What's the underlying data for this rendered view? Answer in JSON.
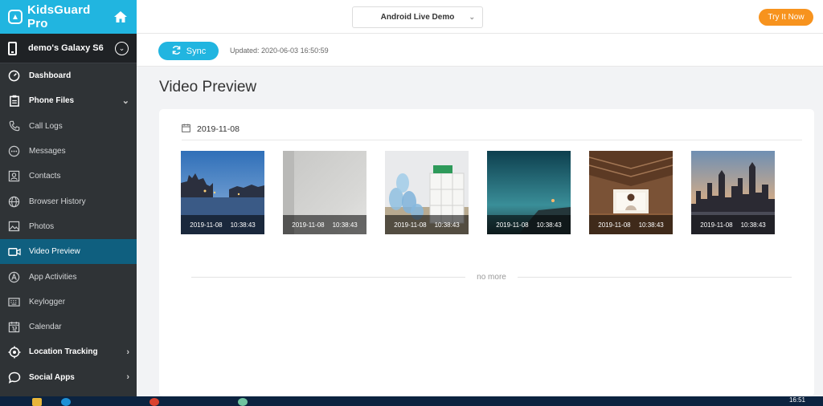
{
  "brand": {
    "name": "KidsGuard Pro"
  },
  "device": {
    "name": "demo's Galaxy S6"
  },
  "sidebar": {
    "items": [
      {
        "label": "Dashboard",
        "icon": "gauge-icon"
      },
      {
        "label": "Phone Files",
        "icon": "clipboard-icon"
      },
      {
        "label": "Call Logs",
        "icon": "phone-icon"
      },
      {
        "label": "Messages",
        "icon": "chat-icon"
      },
      {
        "label": "Contacts",
        "icon": "contact-icon"
      },
      {
        "label": "Browser History",
        "icon": "globe-icon"
      },
      {
        "label": "Photos",
        "icon": "image-icon"
      },
      {
        "label": "Video Preview",
        "icon": "video-icon"
      },
      {
        "label": "App Activities",
        "icon": "app-store-icon"
      },
      {
        "label": "Keylogger",
        "icon": "keyboard-icon"
      },
      {
        "label": "Calendar",
        "icon": "calendar-icon"
      },
      {
        "label": "Location Tracking",
        "icon": "location-icon"
      },
      {
        "label": "Social Apps",
        "icon": "social-chat-icon"
      }
    ]
  },
  "topbar": {
    "demo_label": "Android Live Demo",
    "try_label": "Try It Now"
  },
  "sync": {
    "label": "Sync",
    "updated": "Updated: 2020-06-03 16:50:59"
  },
  "page": {
    "title": "Video Preview"
  },
  "group": {
    "date": "2019-11-08"
  },
  "videos": [
    {
      "date": "2019-11-08",
      "time": "10:38:43"
    },
    {
      "date": "2019-11-08",
      "time": "10:38:43"
    },
    {
      "date": "2019-11-08",
      "time": "10:38:43"
    },
    {
      "date": "2019-11-08",
      "time": "10:38:43"
    },
    {
      "date": "2019-11-08",
      "time": "10:38:43"
    },
    {
      "date": "2019-11-08",
      "time": "10:38:43"
    }
  ],
  "footer": {
    "no_more": "no more"
  },
  "taskbar": {
    "clock": "16:51"
  },
  "colors": {
    "accent": "#21b5e0",
    "sidebar": "#2f3336",
    "active": "#0f5f7f",
    "try": "#f7931e"
  }
}
